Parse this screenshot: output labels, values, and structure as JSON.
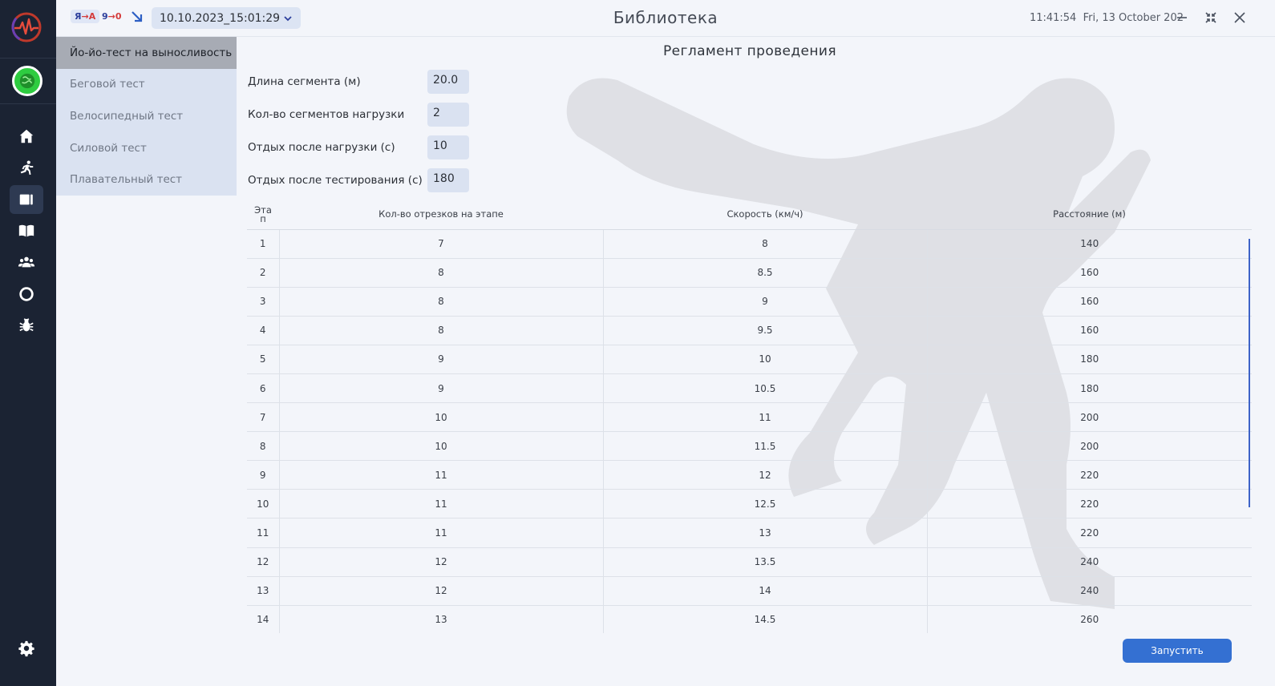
{
  "header": {
    "app_title": "Библиотека",
    "lang_badge_1": {
      "from": "Я",
      "arrow": "→",
      "to": "A"
    },
    "lang_badge_2": {
      "from": "9",
      "arrow": "→",
      "to": "0"
    },
    "session_value": "10.10.2023_15:01:29",
    "clock_time": "11:41:54",
    "clock_date": "Fri, 13 October 202"
  },
  "sidebar": {
    "nav_items": [
      {
        "name": "home-icon"
      },
      {
        "name": "runner-icon"
      },
      {
        "name": "library-icon",
        "active": true
      },
      {
        "name": "book-icon"
      },
      {
        "name": "group-icon"
      },
      {
        "name": "circle-icon"
      },
      {
        "name": "bug-icon"
      }
    ],
    "settings_icon": "gear-icon"
  },
  "tests": [
    {
      "label": "Йо-йо-тест на выносливость",
      "active": true
    },
    {
      "label": "Беговой тест",
      "active": false
    },
    {
      "label": "Велосипедный тест",
      "active": false
    },
    {
      "label": "Силовой тест",
      "active": false
    },
    {
      "label": "Плавательный тест",
      "active": false
    }
  ],
  "main": {
    "section_title": "Регламент проведения",
    "params": [
      {
        "label": "Длина сегмента (м)",
        "value": "20.0"
      },
      {
        "label": "Кол-во сегментов нагрузки",
        "value": "2"
      },
      {
        "label": "Отдых после нагрузки (с)",
        "value": "10"
      },
      {
        "label": "Отдых после тестирования (с)",
        "value": "180"
      }
    ],
    "table": {
      "headers": [
        "Эта\nп",
        "Кол-во отрезков на этапе",
        "Скорость (км/ч)",
        "Расстояние (м)"
      ],
      "rows": [
        [
          "1",
          "7",
          "8",
          "140"
        ],
        [
          "2",
          "8",
          "8.5",
          "160"
        ],
        [
          "3",
          "8",
          "9",
          "160"
        ],
        [
          "4",
          "8",
          "9.5",
          "160"
        ],
        [
          "5",
          "9",
          "10",
          "180"
        ],
        [
          "6",
          "9",
          "10.5",
          "180"
        ],
        [
          "7",
          "10",
          "11",
          "200"
        ],
        [
          "8",
          "10",
          "11.5",
          "200"
        ],
        [
          "9",
          "11",
          "12",
          "220"
        ],
        [
          "10",
          "11",
          "12.5",
          "220"
        ],
        [
          "11",
          "11",
          "13",
          "220"
        ],
        [
          "12",
          "12",
          "13.5",
          "240"
        ],
        [
          "13",
          "12",
          "14",
          "240"
        ],
        [
          "14",
          "13",
          "14.5",
          "260"
        ]
      ]
    },
    "run_button": "Запустить"
  }
}
